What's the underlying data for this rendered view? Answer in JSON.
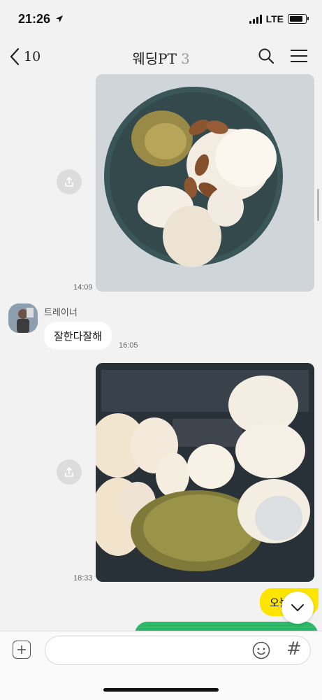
{
  "status_bar": {
    "time": "21:26",
    "network": "LTE",
    "icons": [
      "location-arrow-icon",
      "signal-icon",
      "battery-icon"
    ]
  },
  "header": {
    "back_count": "10",
    "title": "웨딩PT",
    "member_count": "3",
    "icons": [
      "back-chevron-icon",
      "search-icon",
      "menu-icon"
    ]
  },
  "messages": [
    {
      "type": "photo",
      "time": "14:09",
      "content": "eggs-almonds-bowl"
    },
    {
      "type": "text",
      "sender": "트레이너",
      "text": "잘한다잘해",
      "time": "16:05"
    },
    {
      "type": "photo",
      "time": "18:33",
      "content": "eggs-sweet-potato-container"
    },
    {
      "type": "text-outgoing",
      "text": "오늘"
    }
  ],
  "input_bar": {
    "placeholder": "",
    "icons": [
      "plus-icon",
      "emoji-icon",
      "hash-icon"
    ],
    "hash_symbol": "#"
  },
  "colors": {
    "background": "#f2f2f2",
    "my_bubble": "#fee500",
    "incoming_bubble": "#ffffff",
    "green_bubble": "#2fb86a"
  }
}
